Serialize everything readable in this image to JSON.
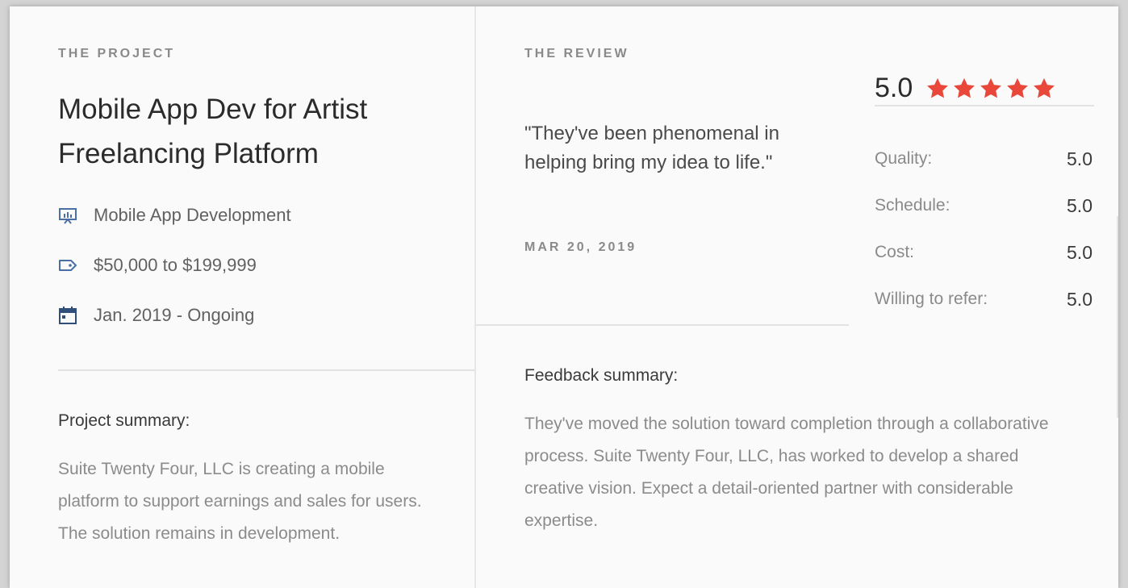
{
  "project": {
    "eyebrow": "THE PROJECT",
    "title": "Mobile App Dev for Artist Freelancing Platform",
    "meta": [
      {
        "icon": "presentation-icon",
        "text": "Mobile App Development"
      },
      {
        "icon": "tag-icon",
        "text": "$50,000 to $199,999"
      },
      {
        "icon": "calendar-icon",
        "text": "Jan. 2019 - Ongoing"
      }
    ],
    "summary_heading": "Project summary:",
    "summary": "Suite Twenty Four, LLC is creating a mobile platform to support earnings and sales for users. The solution remains in development."
  },
  "review": {
    "eyebrow": "THE REVIEW",
    "quote": "\"They've been phenomenal in helping bring my idea to life.\"",
    "date": "MAR 20, 2019",
    "feedback_heading": "Feedback summary:",
    "feedback": "They've moved the solution toward completion through a collaborative process. Suite Twenty Four, LLC, has worked to develop a shared creative vision. Expect a detail-oriented partner with considerable expertise."
  },
  "rating": {
    "overall": "5.0",
    "stars": 5,
    "star_color": "#e8473a",
    "items": [
      {
        "label": "Quality:",
        "value": "5.0"
      },
      {
        "label": "Schedule:",
        "value": "5.0"
      },
      {
        "label": "Cost:",
        "value": "5.0"
      },
      {
        "label": "Willing to refer:",
        "value": "5.0"
      }
    ]
  }
}
